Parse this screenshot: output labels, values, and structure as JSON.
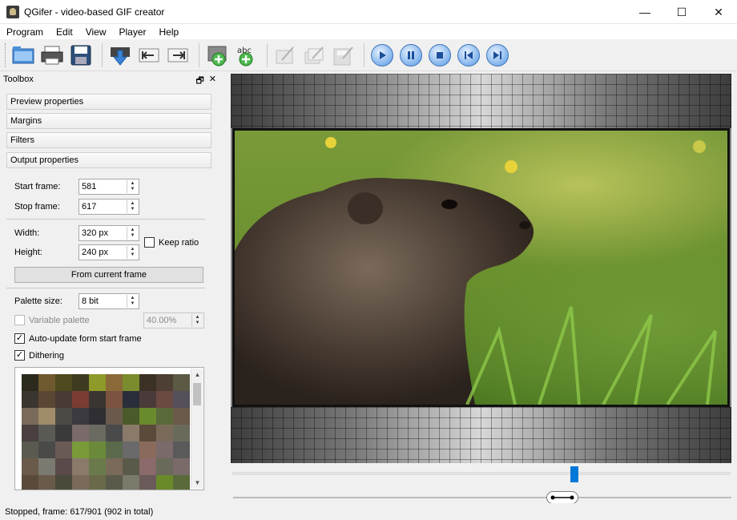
{
  "window": {
    "title": "QGifer - video-based GIF creator",
    "minimize": "—",
    "maximize": "☐",
    "close": "✕"
  },
  "menu": [
    "Program",
    "Edit",
    "View",
    "Player",
    "Help"
  ],
  "toolbox": {
    "title": "Toolbox",
    "float_icon": "🗗",
    "close_icon": "✕",
    "sections": [
      "Preview properties",
      "Margins",
      "Filters",
      "Output properties"
    ],
    "start_frame": {
      "label": "Start frame:",
      "value": "581"
    },
    "stop_frame": {
      "label": "Stop frame:",
      "value": "617"
    },
    "width": {
      "label": "Width:",
      "value": "320 px"
    },
    "height": {
      "label": "Height:",
      "value": "240 px"
    },
    "keep_ratio": {
      "label": "Keep ratio",
      "checked": false
    },
    "from_current_frame": "From current frame",
    "palette_size": {
      "label": "Palette size:",
      "value": "8 bit"
    },
    "variable_palette": {
      "label": "Variable palette",
      "value": "40.00%",
      "checked": false
    },
    "auto_update": {
      "label": "Auto-update form start frame",
      "checked": true
    },
    "dithering": {
      "label": "Dithering",
      "checked": true
    },
    "palette_colors": [
      "#2b2a1d",
      "#6f5a2f",
      "#4e4b20",
      "#3e3a22",
      "#8e9a2a",
      "#8b6a3a",
      "#7a8c2e",
      "#3c3125",
      "#4d3f33",
      "#5c5a45",
      "#3a352e",
      "#5b4634",
      "#4a3a33",
      "#7a3c33",
      "#3a3530",
      "#7b5340",
      "#2a2e3a",
      "#4b3a3a",
      "#6a4a42",
      "#55505a",
      "#7a6a5a",
      "#a08c6a",
      "#4d4a45",
      "#3a3a40",
      "#2e2e33",
      "#6a5a4d",
      "#4a5a2a",
      "#6a8a2e",
      "#5a6a3a",
      "#6a5a4a",
      "#4a4040",
      "#5a5a55",
      "#3a3a3a",
      "#7a6a6a",
      "#6a6a60",
      "#4a4a4a",
      "#8a7a6a",
      "#5a4a3a",
      "#7a6a5a",
      "#6a6a5a",
      "#5a5a50",
      "#4a4a48",
      "#6a5a55",
      "#7a9a3a",
      "#6a8a3a",
      "#5a6a4a",
      "#6a6a6a",
      "#8a6a5a",
      "#7a6a6a",
      "#5a5a5a",
      "#6a5a4a",
      "#7a7a70",
      "#5a4a4a",
      "#8a7a6a",
      "#6a7a4a",
      "#7a6a5a",
      "#5a5a4a",
      "#8a6a6a",
      "#6a6a5a",
      "#7a6a6a",
      "#5a4a3a",
      "#6a5a4a",
      "#4a4a3a",
      "#7a6a5a",
      "#6a6a4a",
      "#5a5a4a",
      "#7a7a6a",
      "#6a5a5a",
      "#6a8a2a",
      "#5a6a3a"
    ]
  },
  "player": {
    "frame_position_fraction": 0.685,
    "range_knob_fraction": 0.66
  },
  "status": "Stopped, frame: 617/901 (902 in total)"
}
